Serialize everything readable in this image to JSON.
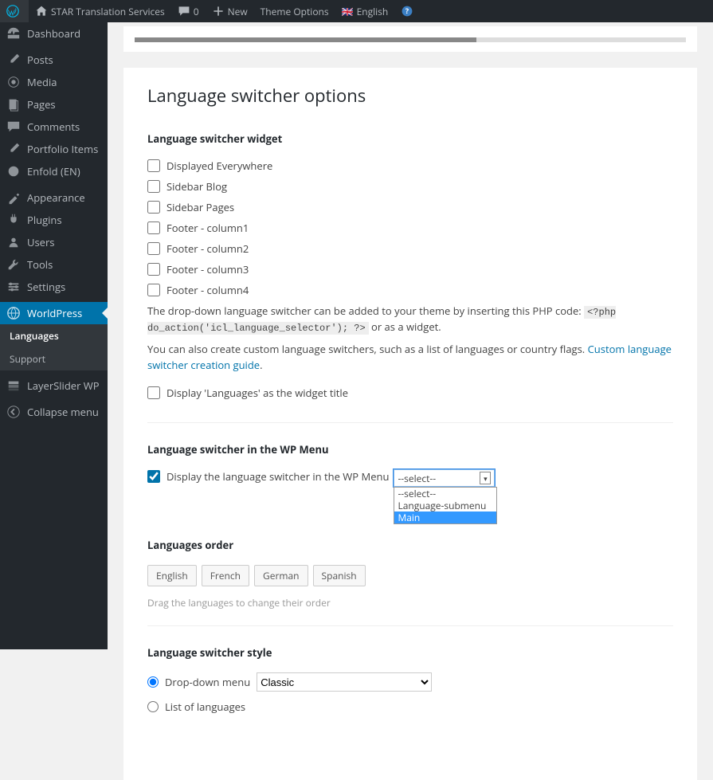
{
  "adminbar": {
    "site_title": "STAR Translation Services",
    "comments_count": "0",
    "new_label": "New",
    "theme_options": "Theme Options",
    "english": "English"
  },
  "sidebar": {
    "dashboard": "Dashboard",
    "posts": "Posts",
    "media": "Media",
    "pages": "Pages",
    "comments": "Comments",
    "portfolio": "Portfolio Items",
    "enfold": "Enfold (EN)",
    "appearance": "Appearance",
    "plugins": "Plugins",
    "users": "Users",
    "tools": "Tools",
    "settings": "Settings",
    "worldpress": "WorldPress",
    "sub_languages": "Languages",
    "sub_support": "Support",
    "layerslider": "LayerSlider WP",
    "collapse": "Collapse menu"
  },
  "page": {
    "title": "Language switcher options",
    "sec_widget_title": "Language switcher widget",
    "cb": {
      "everywhere": "Displayed Everywhere",
      "sidebar_blog": "Sidebar Blog",
      "sidebar_pages": "Sidebar Pages",
      "footer1": "Footer - column1",
      "footer2": "Footer - column2",
      "footer3": "Footer - column3",
      "footer4": "Footer - column4",
      "display_title": "Display 'Languages' as the widget title"
    },
    "desc_php": "The drop-down language switcher can be added to your theme by inserting this PHP code:",
    "php_code": "<?php do_action('icl_language_selector'); ?>",
    "desc_php2": "or as a widget.",
    "desc_custom": "You can also create custom language switchers, such as a list of languages or country flags.",
    "custom_link": "Custom language switcher creation guide",
    "sec_wp_menu": "Language switcher in the WP Menu",
    "cb_wp_menu": "Display the language switcher in the WP Menu",
    "select_placeholder": "--select--",
    "dropdown_opts": [
      "--select--",
      "Language-submenu",
      "Main"
    ],
    "sec_order": "Languages order",
    "langs": [
      "English",
      "French",
      "German",
      "Spanish"
    ],
    "order_hint": "Drag the languages to change their order",
    "sec_style": "Language switcher style",
    "style_dropdown": "Drop-down menu",
    "style_classic": "Classic",
    "style_list": "List of languages"
  }
}
